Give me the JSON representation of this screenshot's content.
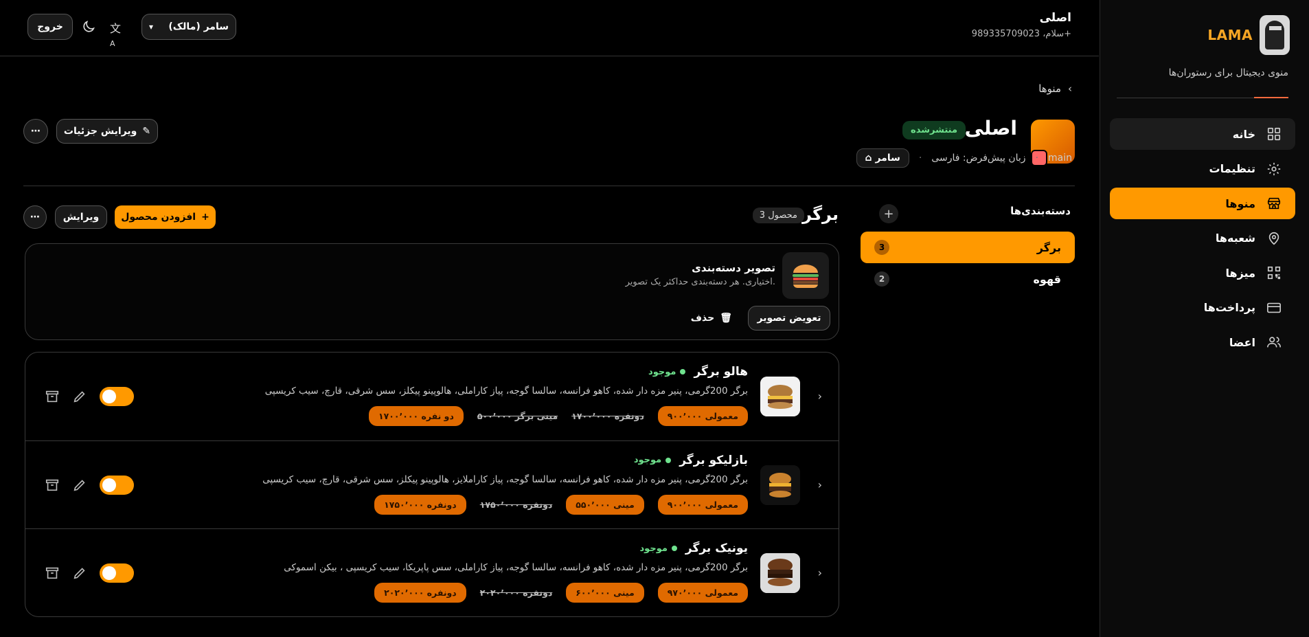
{
  "sidebar": {
    "brand": "LAMA",
    "tagline": "منوی دیجیتال برای رستوران‌ها",
    "items": [
      {
        "label": "خانه",
        "icon": "grid-icon"
      },
      {
        "label": "تنظیمات",
        "icon": "gear-icon"
      },
      {
        "label": "منوها",
        "icon": "store-icon"
      },
      {
        "label": "شعبه‌ها",
        "icon": "map-pin-icon"
      },
      {
        "label": "میزها",
        "icon": "qr-icon"
      },
      {
        "label": "پرداخت‌ها",
        "icon": "card-icon"
      },
      {
        "label": "اعضا",
        "icon": "users-icon"
      }
    ]
  },
  "header": {
    "user_name": "اصلی",
    "greeting": "سلام، 989335709023+",
    "logout": "خروج",
    "role": "سامر (مالک)"
  },
  "page": {
    "breadcrumb": "منوها",
    "title": "اصلی",
    "status": "منتشرشده",
    "slug": "main",
    "default_lang": "زبان پیش‌فرض: فارسی",
    "branch": "سامر",
    "edit_details": "ویرایش جزئیات"
  },
  "categories": {
    "title": "دسته‌بندی‌ها",
    "items": [
      {
        "name": "برگر",
        "count": "3"
      },
      {
        "name": "قهوه",
        "count": "2"
      }
    ]
  },
  "section": {
    "title": "برگر",
    "count": "3 محصول",
    "add_product": "افزودن محصول",
    "edit": "ویرایش",
    "image_title": "تصویر دسته‌بندی",
    "image_sub": "اختیاری. هر دسته‌بندی حداکثر یک تصویر.",
    "replace_image": "تعویض تصویر",
    "delete": "حذف"
  },
  "products": [
    {
      "name": "هالو برگر",
      "status": "موجود",
      "desc": "برگر 200گرمی، پنیر مزه دار شده، کاهو فرانسه، سالسا گوجه، پیاز کاراملی، هالوپینو پیکلز، سس شرقی، قارچ، سیب کریسپی",
      "prices": [
        {
          "label": "معمولی ۹۰۰٬۰۰۰",
          "strike": false
        },
        {
          "label": "دونفره ۱۷۰۰٬۰۰۰",
          "strike": true
        },
        {
          "label": "مینی برگر ۵۰۰٬۰۰۰",
          "strike": true
        },
        {
          "label": "دو نفره ۱۷۰۰٬۰۰۰",
          "strike": false
        }
      ]
    },
    {
      "name": "بازلیکو برگر",
      "status": "موجود",
      "desc": "برگر 200گرمی، پنیر مزه دار شده، کاهو فرانسه، سالسا گوجه، پیاز کاراملایز، هالوپینو پیکلز، سس شرقی، قارچ، سیب کریسپی",
      "prices": [
        {
          "label": "معمولی ۹۰۰٬۰۰۰",
          "strike": false
        },
        {
          "label": "مینی ۵۵۰٬۰۰۰",
          "strike": false
        },
        {
          "label": "دونفره ۱۷۵۰٬۰۰۰",
          "strike": true
        },
        {
          "label": "دونفره ۱۷۵۰٬۰۰۰",
          "strike": false
        }
      ]
    },
    {
      "name": "یونیک برگر",
      "status": "موجود",
      "desc": "برگر 200گرمی، پنیر مزه دار شده، کاهو فرانسه، سالسا گوجه، پیاز کاراملی، سس پاپریکا، سیب کریسپی ، بیکن اسموکی",
      "prices": [
        {
          "label": "معمولی ۹۷۰٬۰۰۰",
          "strike": false
        },
        {
          "label": "مینی ۶۰۰٬۰۰۰",
          "strike": false
        },
        {
          "label": "دونفره ۲۰۲۰٬۰۰۰",
          "strike": true
        },
        {
          "label": "دونفره ۲۰۲۰٬۰۰۰",
          "strike": false
        }
      ]
    }
  ]
}
